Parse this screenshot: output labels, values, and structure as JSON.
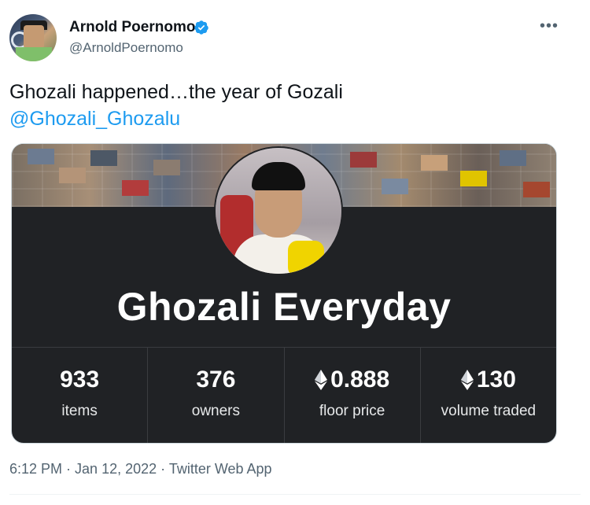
{
  "tweet": {
    "author": {
      "name": "Arnold Poernomo",
      "handle": "@ArnoldPoernomo",
      "verified": true
    },
    "text_line1": "Ghozali happened…the year of Gozali",
    "mention": "@Ghozali_Ghozalu",
    "more_icon": "more-horizontal-icon",
    "meta": {
      "time": "6:12 PM",
      "separator1": " · ",
      "date": "Jan 12, 2022",
      "separator2": " · ",
      "source": "Twitter Web App"
    }
  },
  "card": {
    "collection_name": "Ghozali Everyday",
    "stats": [
      {
        "value": "933",
        "label": "items",
        "eth": false
      },
      {
        "value": "376",
        "label": "owners",
        "eth": false
      },
      {
        "value": "0.888",
        "label": "floor price",
        "eth": true
      },
      {
        "value": "130",
        "label": "volume traded",
        "eth": true
      }
    ]
  },
  "colors": {
    "accent": "#1d9bf0",
    "card_bg": "#202225",
    "text_secondary": "#536471"
  }
}
